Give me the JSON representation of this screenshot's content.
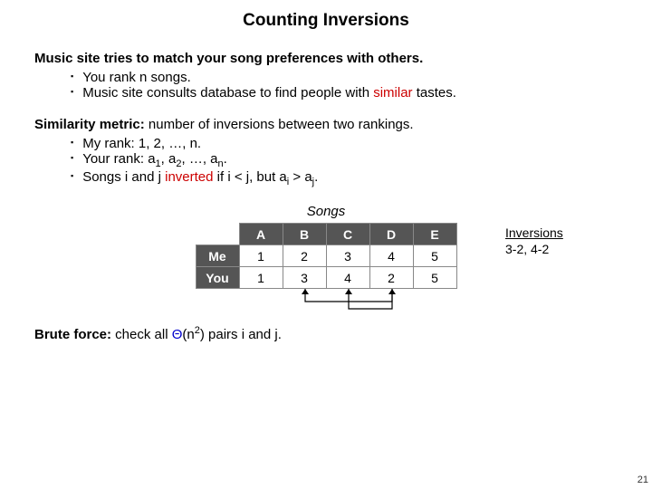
{
  "title": "Counting Inversions",
  "intro": "Music site tries to match your song preferences with others.",
  "intro_bullets": [
    {
      "text": "You rank n songs."
    },
    {
      "text_pre": "Music site consults database to find people with ",
      "hl": "similar",
      "text_post": " tastes."
    }
  ],
  "metric_pre": "Similarity metric:",
  "metric_post": "  number of inversions between two rankings.",
  "metric_bullets": {
    "b1": "My rank:  1, 2, …, n.",
    "b2_pre": "Your rank:  a",
    "b2_mid": ", a",
    "b2_post": ", …, a",
    "b2_end": ".",
    "b3_pre": "Songs i and j ",
    "b3_hl": "inverted",
    "b3_mid": " if i < j, but a",
    "b3_mid2": " > a",
    "b3_end": "."
  },
  "songs_label": "Songs",
  "table": {
    "cols": [
      "A",
      "B",
      "C",
      "D",
      "E"
    ],
    "rows": [
      {
        "label": "Me",
        "vals": [
          "1",
          "2",
          "3",
          "4",
          "5"
        ]
      },
      {
        "label": "You",
        "vals": [
          "1",
          "3",
          "4",
          "2",
          "5"
        ]
      }
    ]
  },
  "inversions": {
    "label": "Inversions",
    "items": "3-2, 4-2"
  },
  "brute_pre": "Brute force:",
  "brute_mid": "  check all ",
  "brute_theta": "Θ",
  "brute_open": "(n",
  "brute_exp": "2",
  "brute_post": ") pairs i and j.",
  "pagenum": "21"
}
